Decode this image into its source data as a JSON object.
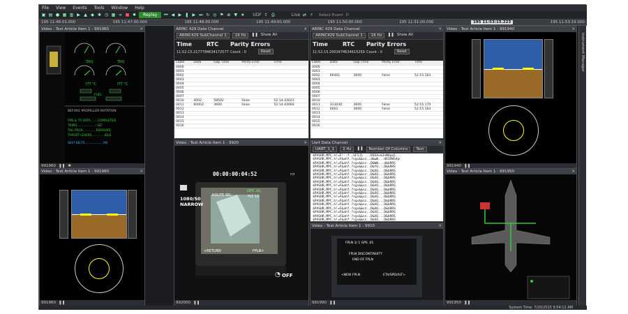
{
  "menu": [
    "File",
    "View",
    "Events",
    "Tools",
    "Window",
    "Help"
  ],
  "toolbar": {
    "replay_label": "Replay",
    "udf": "UDF",
    "live": "Live",
    "select_event": "Select Event"
  },
  "timeline": {
    "ticks": [
      "195 11:46:01.000",
      "195 11:47:00.000",
      "195 11:48:00.000",
      "195 11:49:00.000",
      "195 11:50:00.000",
      "195 11:51:00.000"
    ],
    "current": "195 11:53:15.223",
    "end": "195 11:53:19.000"
  },
  "side_tab": "Instrument Manager",
  "panes": {
    "top_left": {
      "title": "Video : Test Article Item 1 - 991960",
      "foot": "991960"
    },
    "bottom_left": {
      "title": "Video : Test Article Item 1 - 991960",
      "foot": "991960"
    },
    "top_right": {
      "title": "Video : Test Article Item 1 - 991940",
      "foot": "991940"
    },
    "bottom_right": {
      "title": "Video : Test Article Item 1 - 991950",
      "foot": "991950"
    },
    "video_center": {
      "title": "Video : Test Article Item 1 - 9920",
      "foot": "992000",
      "timecode": "00:00:00:04:52",
      "mode": "1080/50\nNARROW",
      "wifi": "OFF",
      "route": "ROUTE SEL",
      "gps": "GPS .01",
      "flt": "FLT 13",
      "return": "<RETURN",
      "fpln": "FPLN>"
    },
    "video_small": {
      "title": "Video : Test Article Item 1 - 9910",
      "foot": "991990",
      "fpln_title": "FPLN 1/ 1 GPS .01",
      "disc": "FPLN DISCONTINUITY",
      "end": "END OF FPLN",
      "new": "<NEW FPLN",
      "eta": "ETA/SPD/ALT>"
    }
  },
  "arinc": [
    {
      "title": "ARINC 429 Data Channel",
      "channel": "ARINC429 SubChannel 1",
      "rate": "16 Hz",
      "show": "Show All",
      "time_label": "Time",
      "rtc_label": "RTC",
      "parity_label": "Parity Errors",
      "time": "11:52:15.217778",
      "rtc": "4634172577",
      "count": "Count : 0",
      "reset": "Reset",
      "headers": [
        "Label",
        "Data",
        "Gap Time",
        "Parity Error",
        "Time"
      ],
      "rows": [
        [
          "0000",
          "",
          "",
          "",
          ""
        ],
        [
          "0001",
          "",
          "",
          "",
          ""
        ],
        [
          "0002",
          "",
          "",
          "",
          ""
        ],
        [
          "0003",
          "",
          "",
          "",
          ""
        ],
        [
          "0004",
          "",
          "",
          "",
          ""
        ],
        [
          "0005",
          "",
          "",
          "",
          ""
        ],
        [
          "0006",
          "",
          "",
          "",
          ""
        ],
        [
          "0007",
          "",
          "",
          "",
          ""
        ],
        [
          "0010",
          "10",
          "4002",
          "58502",
          "False",
          "52:14.43023"
        ],
        [
          "0011",
          "11",
          "60002",
          "3600",
          "False",
          "52:14.43060"
        ],
        [
          "0012",
          "",
          "",
          "",
          ""
        ],
        [
          "0013",
          "",
          "",
          "",
          ""
        ],
        [
          "0014",
          "",
          "",
          "",
          ""
        ],
        [
          "0015",
          "",
          "",
          "",
          ""
        ],
        [
          "0016",
          "",
          "",
          "",
          ""
        ]
      ]
    },
    {
      "title": "ARINC 429 Data Channel",
      "channel": "ARINC429 SubChannel 1",
      "rate": "16 Hz",
      "show": "Show All",
      "time_label": "Time",
      "rtc_label": "RTC",
      "parity_label": "Parity Errors",
      "time": "11:52:15.200347",
      "rtc": "4634615259",
      "count": "Count : 0",
      "reset": "Reset",
      "headers": [
        "Label",
        "Data",
        "Gap Time",
        "Parity Error",
        "Time"
      ],
      "rows": [
        [
          "0000",
          "",
          "",
          "",
          ""
        ],
        [
          "0001",
          "",
          "",
          "",
          ""
        ],
        [
          "0002",
          "2",
          "66401",
          "3600",
          "False",
          "52:15.163"
        ],
        [
          "0003",
          "",
          "",
          "",
          ""
        ],
        [
          "0004",
          "",
          "",
          "",
          ""
        ],
        [
          "0005",
          "",
          "",
          "",
          ""
        ],
        [
          "0006",
          "",
          "",
          "",
          ""
        ],
        [
          "0007",
          "",
          "",
          "",
          ""
        ],
        [
          "0010",
          "",
          "",
          "",
          ""
        ],
        [
          "0011",
          "13",
          "313030",
          "3600",
          "False",
          "52:15.170"
        ],
        [
          "0012",
          "12",
          "0001",
          "3600",
          "False",
          "52:15.163"
        ],
        [
          "0013",
          "",
          "",
          "",
          ""
        ],
        [
          "0014",
          "",
          "",
          "",
          ""
        ],
        [
          "0015",
          "",
          "",
          "",
          ""
        ],
        [
          "0016",
          "",
          "",
          "",
          ""
        ]
      ]
    }
  ],
  "uart": {
    "title": "Uart Data Channel",
    "sub": "UART_1_1",
    "rate": "2 Hz",
    "cols": "Number Of Columns",
    "text": "Text",
    "lines": [
      "$PASHR,MPC,h!=F!-.f.,SFIJ1 ...DSEA<mJnNVpq1...",
      "$PASHR,MPC,h!=F&ahf.?sgs&&sz..d&wW...HDIOWS4@",
      "$PASHR,MPC,h!=F&ahf.?sgs&&sz..D&WW...d&bRRS",
      "$PASHR,MPC,h!=F&ahf.?sgs&&sz..D&YQ...D&bRRS",
      "$PASHR,MPC,h!=F&ahf.?sgs&&sz..D&XQ...D&bRRS",
      "$PASHR,MPC,h!=F&ahf.?sgs&&sz..D&XQ...D&bRRS",
      "$PASHR,MPC,h!=F&ahf.?sgs&&sz..D&XQ...D&bRRS",
      "$PASHR,MPC,h!=F&ahf.?sgs&&sz..D&XQ...D&bRRS",
      "$PASHR,MPC,h!=F&ahf.?sgs&&sz..D&XQ...D&bRRS",
      "$PASHR,MPC,h!=F&ahf.?sgs&&sz..D&XQ...D&bRRS",
      "$PASHR,MPC,h!=F&ahf.?sgs&&sz..D&XQ...D&bRRS",
      "$PASHR,MPC,h!=F&ahf.?sgs&&sz..D&XQ...D&bRRS",
      "$PASHR,MPC,h!=F&ahf.?sgs&&sz..D&XQ...D&bRRS",
      "$PASHR,MPC,h!=F&ahf.?sgs&&sz..D&XQ...D&bRRS",
      "$PASHR,MPC,h!=F&ahf.?sgs&&sz..D&XQ...D&bRRS",
      "$PASHR,MPC,h!=F&ahf.?sgs&&sz..D&XQ...D&bRRS",
      "$PASHR,MPC,h!=F&ahf.?sgs&&sz..D&XQ...D&bRRS",
      "$PASHR,MPC,h!=F&ahf.?sgs&&sz..D&XQ...D&bRRS"
    ]
  },
  "engine": {
    "lines": [
      "BEFORE PROPELLER ROTATION",
      "FMS & TO DATA........COMPLETED",
      "TRIMS......................SET",
      "TAIL PROP...............REMOVED",
      "THRUST LEVERS..............IDLE",
      "SEAT BELTS....................ON"
    ]
  },
  "status": {
    "system_time": "System Time: 7/20/2015 9:54:12 AM"
  },
  "colors": {
    "accent": "#2c8b2c",
    "sky": "#2f5ea8",
    "ground": "#9a6a28"
  }
}
